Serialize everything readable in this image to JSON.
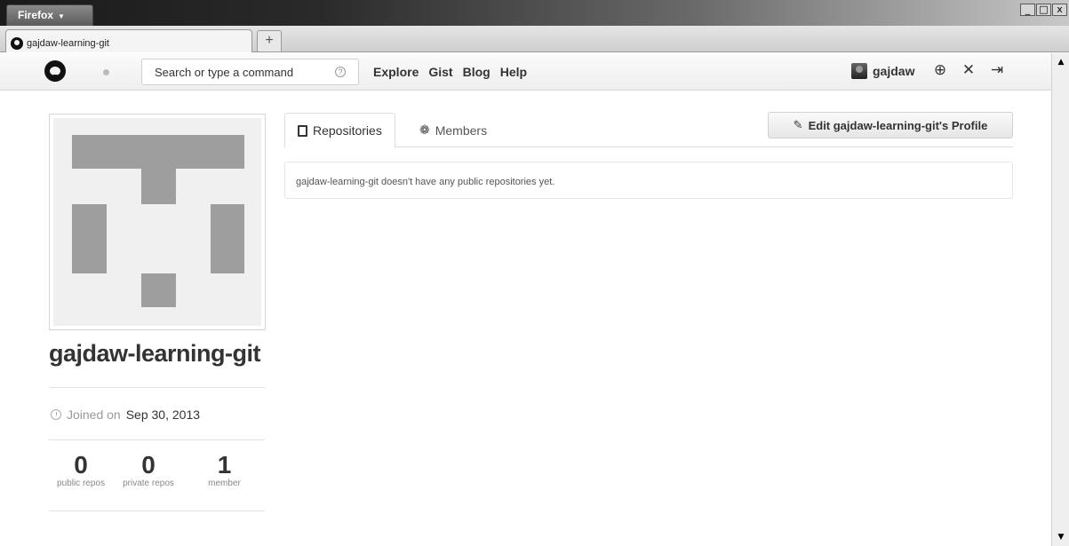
{
  "browser": {
    "app_menu": "Firefox",
    "tab_title": "gajdaw-learning-git",
    "new_tab_symbol": "+",
    "window_controls": [
      "_",
      "□",
      "x"
    ]
  },
  "header": {
    "search_placeholder": "Search or type a command",
    "help_symbol": "?",
    "nav": [
      "Explore",
      "Gist",
      "Blog",
      "Help"
    ],
    "username": "gajdaw",
    "icons": [
      "create-repo-icon",
      "settings-icon",
      "sign-out-icon"
    ]
  },
  "profile": {
    "name": "gajdaw-learning-git",
    "joined_prefix": "Joined on",
    "joined_date": "Sep 30, 2013",
    "stats": [
      {
        "value": "0",
        "label": "public repos"
      },
      {
        "value": "0",
        "label": "private repos"
      },
      {
        "value": "1",
        "label": "member"
      }
    ]
  },
  "main": {
    "tabs": [
      "Repositories",
      "Members"
    ],
    "selected_tab": "Repositories",
    "edit_button": "Edit gajdaw-learning-git's Profile",
    "empty_message": "gajdaw-learning-git doesn't have any public repositories yet."
  },
  "colors": {
    "identicon": "#9e9e9e",
    "identicon_bg": "#f0f0f0"
  }
}
